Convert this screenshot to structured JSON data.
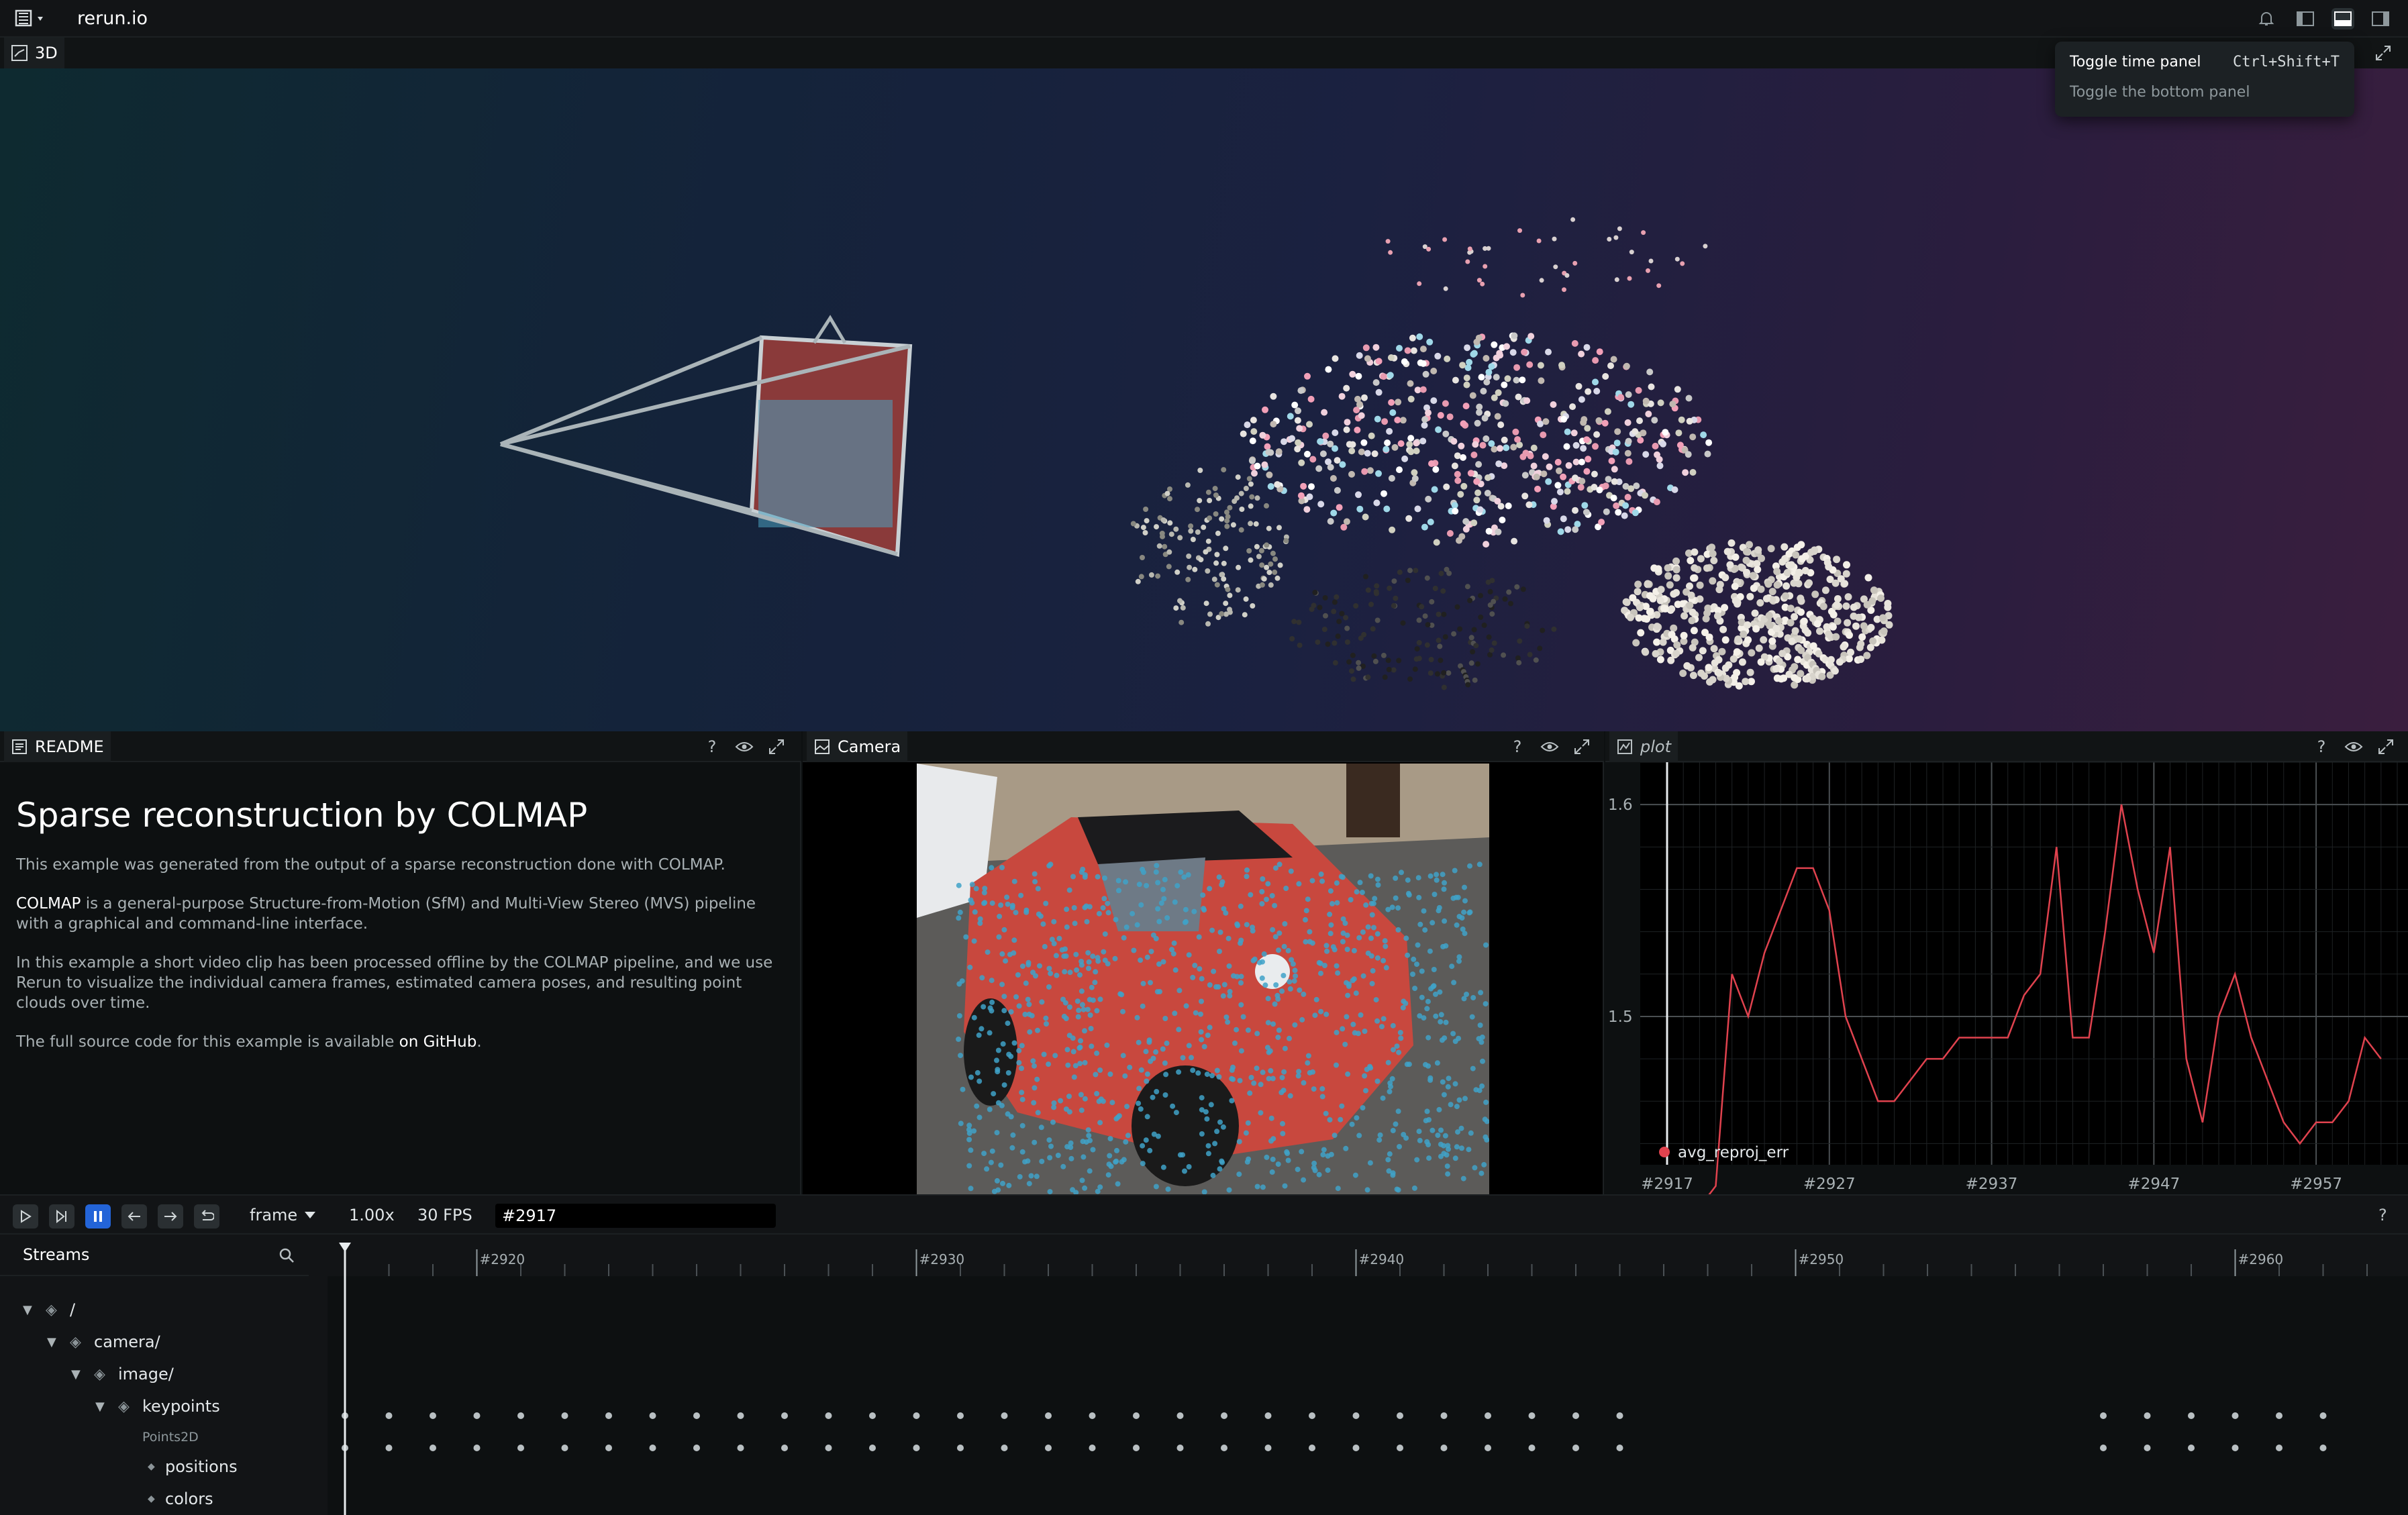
{
  "app": {
    "title": "rerun.io"
  },
  "view3d": {
    "tab_label": "3D"
  },
  "tooltip": {
    "title": "Toggle time panel",
    "shortcut": "Ctrl+Shift+T",
    "description": "Toggle the bottom panel"
  },
  "readme": {
    "tab_label": "README",
    "heading": "Sparse reconstruction by COLMAP",
    "p1": "This example was generated from the output of a sparse reconstruction done with COLMAP.",
    "p2_lead": "COLMAP",
    "p2_rest": " is a general-purpose Structure-from-Motion (SfM) and Multi-View Stereo (MVS) pipeline with a graphical and command-line interface.",
    "p3": "In this example a short video clip has been processed offline by the COLMAP pipeline, and we use Rerun to visualize the individual camera frames, estimated camera poses, and resulting point clouds over time.",
    "p4_lead": "The full source code for this example is available ",
    "p4_link": "on GitHub",
    "p4_end": "."
  },
  "camera": {
    "tab_label": "Camera"
  },
  "plot": {
    "tab_label": "plot",
    "legend_label": "avg_reproj_err",
    "y_ticks": [
      "1.6",
      "1.5"
    ],
    "x_ticks": [
      "#2917",
      "#2927",
      "#2937",
      "#2947",
      "#2957"
    ]
  },
  "chart_data": {
    "type": "line",
    "series": [
      {
        "name": "avg_reproj_err",
        "color": "#e0424e",
        "x": [
          2917,
          2918,
          2919,
          2920,
          2921,
          2922,
          2923,
          2924,
          2925,
          2926,
          2927,
          2928,
          2929,
          2930,
          2931,
          2932,
          2933,
          2934,
          2935,
          2936,
          2937,
          2938,
          2939,
          2940,
          2941,
          2942,
          2943,
          2944,
          2945,
          2946,
          2947,
          2948,
          2949,
          2950,
          2951,
          2952,
          2953,
          2954,
          2955,
          2956,
          2957,
          2958,
          2959,
          2960,
          2961
        ],
        "values": [
          1.38,
          1.39,
          1.41,
          1.42,
          1.52,
          1.5,
          1.53,
          1.55,
          1.57,
          1.57,
          1.55,
          1.5,
          1.48,
          1.46,
          1.46,
          1.47,
          1.48,
          1.48,
          1.49,
          1.49,
          1.49,
          1.49,
          1.51,
          1.52,
          1.58,
          1.49,
          1.49,
          1.54,
          1.6,
          1.56,
          1.53,
          1.58,
          1.48,
          1.45,
          1.5,
          1.52,
          1.49,
          1.47,
          1.45,
          1.44,
          1.45,
          1.45,
          1.46,
          1.49,
          1.48
        ]
      }
    ],
    "xlim": [
      2917,
      2962
    ],
    "ylim": [
      1.43,
      1.62
    ],
    "grid": true,
    "legend": "bottom-left"
  },
  "timepanel": {
    "timeline_select": "frame",
    "speed": "1.00x",
    "fps": "30 FPS",
    "current_time": "#2917",
    "help": "?"
  },
  "streams": {
    "title": "Streams",
    "tree": [
      {
        "label": "/"
      },
      {
        "label": "camera/"
      },
      {
        "label": "image/"
      },
      {
        "label": "keypoints"
      },
      {
        "label": "Points2D"
      },
      {
        "label": "positions"
      },
      {
        "label": "colors"
      }
    ]
  },
  "timeline": {
    "ticks": [
      "#2920",
      "#2930",
      "#2940",
      "#2950",
      "#2960"
    ]
  },
  "colors": {
    "accent": "#2364d8",
    "plot_line": "#e0424e",
    "panel_bg": "#0d1011"
  }
}
